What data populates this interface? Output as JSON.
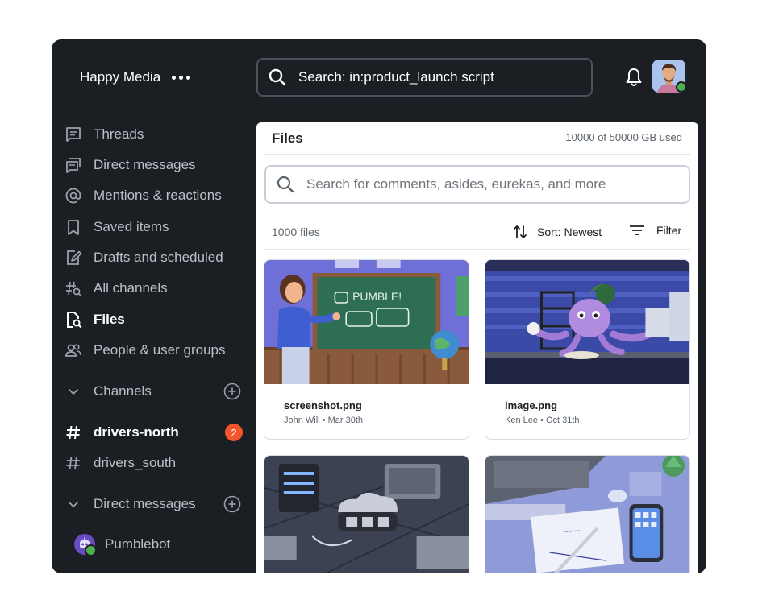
{
  "workspace": {
    "name": "Happy Media"
  },
  "search": {
    "query": "Search: in:product_launch script"
  },
  "nav": {
    "items": [
      {
        "label": "Threads"
      },
      {
        "label": "Direct messages"
      },
      {
        "label": "Mentions & reactions"
      },
      {
        "label": "Saved items"
      },
      {
        "label": "Drafts and scheduled"
      },
      {
        "label": "All channels"
      },
      {
        "label": "Files"
      },
      {
        "label": "People & user groups"
      }
    ],
    "channels_header": "Channels",
    "channels": [
      {
        "name": "drivers-north",
        "badge": "2"
      },
      {
        "name": "drivers_south"
      }
    ],
    "dm_header": "Direct messages",
    "dms": [
      {
        "name": "Pumblebot"
      }
    ]
  },
  "files": {
    "title": "Files",
    "storage": "10000 of 50000 GB used",
    "search_placeholder": "Search for comments, asides, eurekas, and more",
    "count": "1000 files",
    "sort_label": "Sort: Newest",
    "filter_label": "Filter",
    "items": [
      {
        "name": "screenshot.png",
        "meta": "John Will • Mar 30th",
        "board_text": "PUMBLE!"
      },
      {
        "name": "image.png",
        "meta": "Ken Lee • Oct 31th"
      },
      {
        "name": "",
        "meta": ""
      },
      {
        "name": "",
        "meta": ""
      }
    ]
  },
  "colors": {
    "accent_badge": "#f5552b",
    "online": "#4caf50",
    "sidebar_bg": "#1b1f23"
  }
}
